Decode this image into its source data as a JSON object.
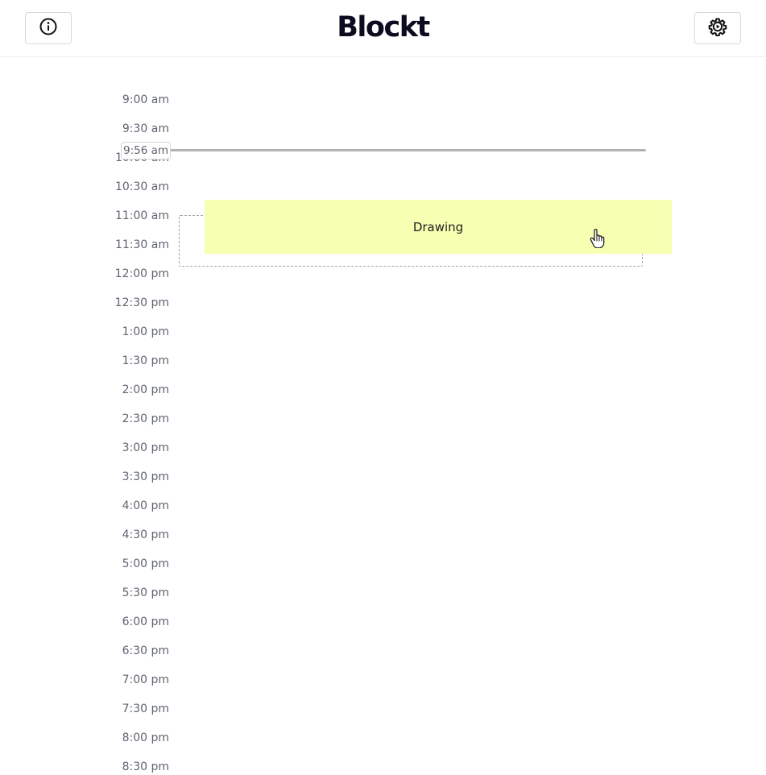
{
  "header": {
    "title": "Blockt",
    "info_icon": "info-circle-icon",
    "settings_icon": "gear-play-icon"
  },
  "timeline": {
    "slots": [
      "9:00 am",
      "9:30 am",
      "10:00 am",
      "10:30 am",
      "11:00 am",
      "11:30 am",
      "12:00 pm",
      "12:30 pm",
      "1:00 pm",
      "1:30 pm",
      "2:00 pm",
      "2:30 pm",
      "3:00 pm",
      "3:30 pm",
      "4:00 pm",
      "4:30 pm",
      "5:00 pm",
      "5:30 pm",
      "6:00 pm",
      "6:30 pm",
      "7:00 pm",
      "7:30 pm",
      "8:00 pm",
      "8:30 pm"
    ],
    "current_time": "9:56 am",
    "block": {
      "label": "Drawing",
      "color": "#f7ffb3"
    }
  },
  "colors": {
    "title": "#0c0c1f",
    "time_label": "#5f6470",
    "now_line": "#b3b3b3"
  }
}
